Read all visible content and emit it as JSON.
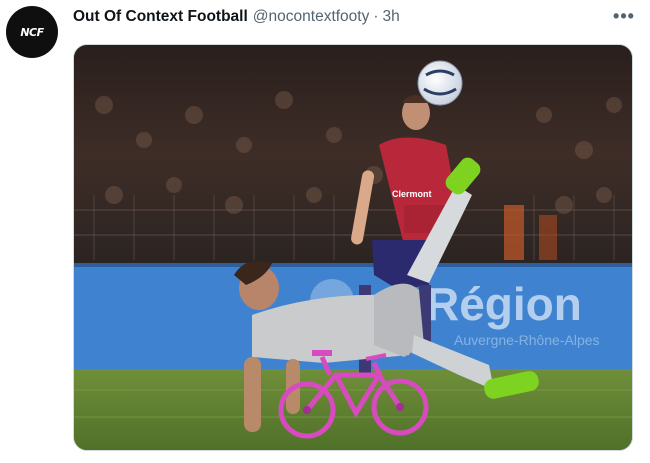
{
  "tweet": {
    "avatar_text": "NCF",
    "display_name": "Out Of Context Football",
    "handle": "@nocontextfooty",
    "separator": "·",
    "timestamp": "3h",
    "more_icon": "more-horizontal-icon",
    "more_label": "•••"
  },
  "media": {
    "banner_text": "Région",
    "shirt_text": "Clermont",
    "colors": {
      "banner": "#3f83d0",
      "pitch": "#5a7d30",
      "shirt_red": "#b8283a",
      "bike_pink": "#d84bc0",
      "boot_green": "#7ed321"
    }
  }
}
